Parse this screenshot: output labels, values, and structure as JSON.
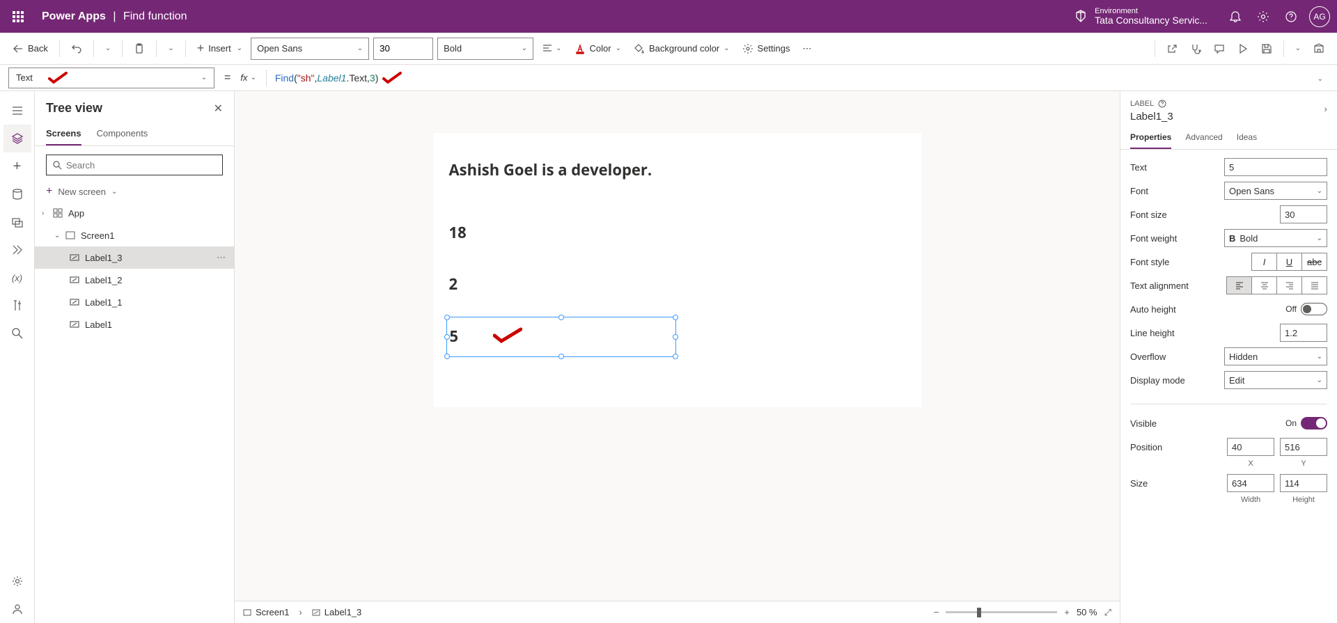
{
  "header": {
    "app_name": "Power Apps",
    "page_title": "Find function",
    "env_label": "Environment",
    "env_name": "Tata Consultancy Servic...",
    "avatar": "AG"
  },
  "cmdbar": {
    "back": "Back",
    "insert": "Insert",
    "font": "Open Sans",
    "font_size": "30",
    "font_weight": "Bold",
    "color": "Color",
    "bgcolor": "Background color",
    "settings": "Settings"
  },
  "formula": {
    "property": "Text",
    "fx": "fx",
    "fn": "Find",
    "open": "(",
    "str": "\"sh\"",
    "comma": ", ",
    "obj": "Label1",
    "dot_text": ".Text",
    "comma2": ",",
    "num": "3",
    "close": ")"
  },
  "tree": {
    "title": "Tree view",
    "tab_screens": "Screens",
    "tab_components": "Components",
    "search_placeholder": "Search",
    "new_screen": "New screen",
    "items": {
      "app": "App",
      "screen1": "Screen1",
      "label1_3": "Label1_3",
      "label1_2": "Label1_2",
      "label1_1": "Label1_1",
      "label1": "Label1"
    }
  },
  "canvas": {
    "label1": "Ashish Goel is a developer.",
    "label1_1": "18",
    "label1_2": "2",
    "label1_3": "5"
  },
  "breadcrumb": {
    "screen": "Screen1",
    "item": "Label1_3",
    "zoom": "50  %"
  },
  "props": {
    "type_label": "LABEL",
    "name": "Label1_3",
    "tab_props": "Properties",
    "tab_adv": "Advanced",
    "tab_ideas": "Ideas",
    "rows": {
      "text_lbl": "Text",
      "text_val": "5",
      "font_lbl": "Font",
      "font_val": "Open Sans",
      "fontsize_lbl": "Font size",
      "fontsize_val": "30",
      "fontweight_lbl": "Font weight",
      "fontweight_val": "Bold",
      "fontstyle_lbl": "Font style",
      "textalign_lbl": "Text alignment",
      "autoheight_lbl": "Auto height",
      "autoheight_val": "Off",
      "lineheight_lbl": "Line height",
      "lineheight_val": "1.2",
      "overflow_lbl": "Overflow",
      "overflow_val": "Hidden",
      "displaymode_lbl": "Display mode",
      "displaymode_val": "Edit",
      "visible_lbl": "Visible",
      "visible_val": "On",
      "position_lbl": "Position",
      "position_x": "40",
      "position_y": "516",
      "size_lbl": "Size",
      "size_w": "634",
      "size_h": "114",
      "x_lbl": "X",
      "y_lbl": "Y",
      "w_lbl": "Width",
      "h_lbl": "Height"
    }
  }
}
